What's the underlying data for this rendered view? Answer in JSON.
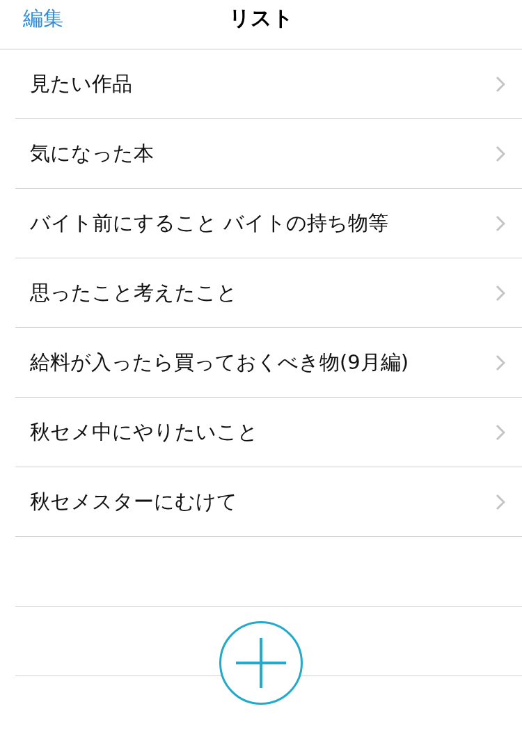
{
  "nav": {
    "edit_label": "編集",
    "title": "リスト"
  },
  "lists": [
    {
      "title": "見たい作品"
    },
    {
      "title": "気になった本"
    },
    {
      "title": "バイト前にすること バイトの持ち物等"
    },
    {
      "title": "思ったこと考えたこと"
    },
    {
      "title": "給料が入ったら買っておくべき物(9月編)"
    },
    {
      "title": "秋セメ中にやりたいこと"
    },
    {
      "title": "秋セメスターにむけて"
    }
  ]
}
